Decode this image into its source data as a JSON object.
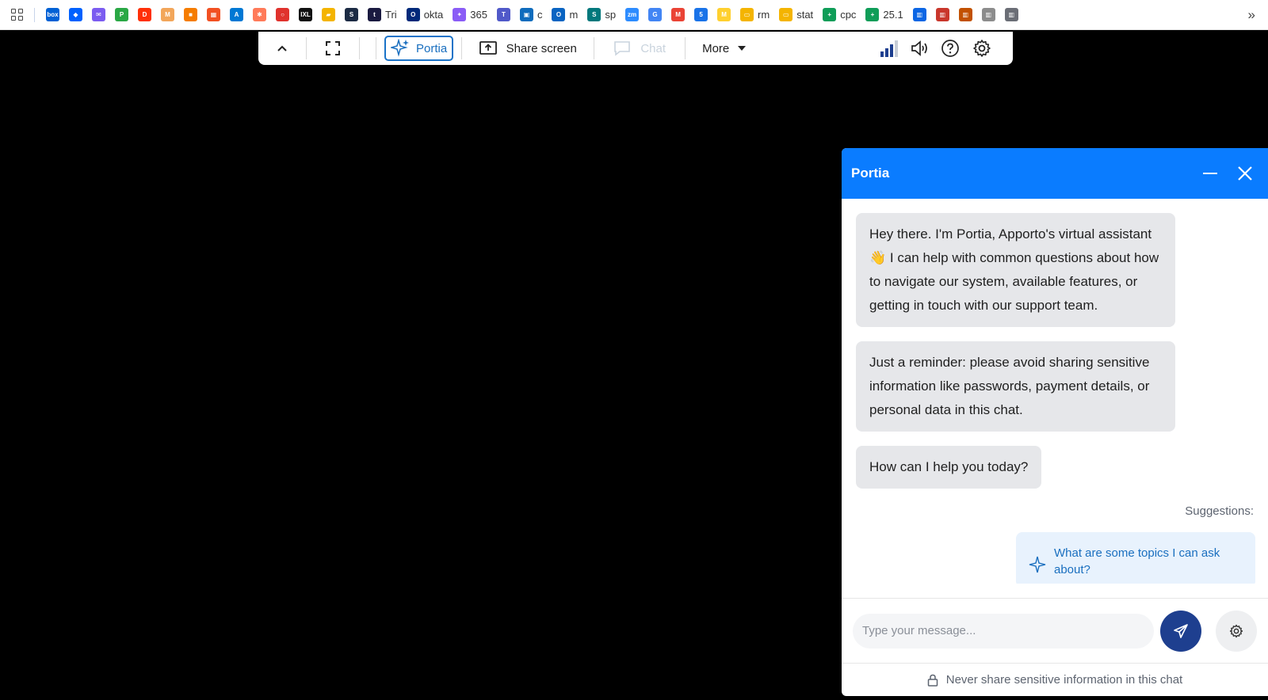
{
  "bookmarks": [
    {
      "icon": "apps-grid-icon",
      "label": ""
    },
    {
      "icon": "box-icon",
      "label": "",
      "color": "#0061d5",
      "glyph": "box"
    },
    {
      "icon": "dropbox-icon",
      "label": "",
      "color": "#0061fe",
      "glyph": "◆"
    },
    {
      "icon": "mail-icon",
      "label": "",
      "color": "#7b5cf0",
      "glyph": "✉"
    },
    {
      "icon": "p-icon",
      "label": "",
      "color": "#2aa845",
      "glyph": "P"
    },
    {
      "icon": "doordash-icon",
      "label": "",
      "color": "#ff3008",
      "glyph": "D"
    },
    {
      "icon": "m-icon",
      "label": "",
      "color": "#f2a65a",
      "glyph": "M"
    },
    {
      "icon": "cube-icon",
      "label": "",
      "color": "#f57c00",
      "glyph": "■"
    },
    {
      "icon": "microsoft-icon",
      "label": "",
      "color": "#f25022",
      "glyph": "▦"
    },
    {
      "icon": "azure-icon",
      "label": "",
      "color": "#0078d4",
      "glyph": "A"
    },
    {
      "icon": "hubspot-icon",
      "label": "",
      "color": "#ff7a59",
      "glyph": "✱"
    },
    {
      "icon": "ring-icon",
      "label": "",
      "color": "#e0322d",
      "glyph": "○"
    },
    {
      "icon": "ixl-icon",
      "label": "",
      "color": "#111111",
      "glyph": "IXL"
    },
    {
      "icon": "folder-icon",
      "label": "",
      "color": "#f4b400",
      "glyph": "▰"
    },
    {
      "icon": "s-icon",
      "label": "",
      "color": "#1c2b44",
      "glyph": "S"
    },
    {
      "icon": "t-icon",
      "label": "Tri",
      "color": "#1a1a40",
      "glyph": "t"
    },
    {
      "icon": "okta-icon",
      "label": "okta",
      "color": "#00297a",
      "glyph": "O"
    },
    {
      "icon": "copilot-icon",
      "label": "365",
      "color": "#8a5cf6",
      "glyph": "✦"
    },
    {
      "icon": "teams-icon",
      "label": "",
      "color": "#5059c9",
      "glyph": "T"
    },
    {
      "icon": "calendar-icon",
      "label": "c",
      "color": "#0f6cbd",
      "glyph": "▣"
    },
    {
      "icon": "outlook-icon",
      "label": "m",
      "color": "#0a64c2",
      "glyph": "O"
    },
    {
      "icon": "sharepoint-icon",
      "label": "sp",
      "color": "#03787c",
      "glyph": "S"
    },
    {
      "icon": "zoom-icon",
      "label": "",
      "color": "#2d8cff",
      "glyph": "zm"
    },
    {
      "icon": "google-icon",
      "label": "",
      "color": "#4285f4",
      "glyph": "G"
    },
    {
      "icon": "gmail-icon",
      "label": "",
      "color": "#ea4335",
      "glyph": "M"
    },
    {
      "icon": "calendar-5-icon",
      "label": "",
      "color": "#1a73e8",
      "glyph": "5"
    },
    {
      "icon": "miro-icon",
      "label": "",
      "color": "#ffd02f",
      "glyph": "M"
    },
    {
      "icon": "slides-icon",
      "label": "rm",
      "color": "#f4b400",
      "glyph": "▭"
    },
    {
      "icon": "slides-icon",
      "label": "stat",
      "color": "#f4b400",
      "glyph": "▭"
    },
    {
      "icon": "sheets-icon",
      "label": "cpc",
      "color": "#0f9d58",
      "glyph": "+"
    },
    {
      "icon": "sheets-icon",
      "label": "25.1",
      "color": "#0f9d58",
      "glyph": "+"
    },
    {
      "icon": "trello-icon",
      "label": "",
      "color": "#0c66e4",
      "glyph": "▥"
    },
    {
      "icon": "trello-icon",
      "label": "",
      "color": "#c9372c",
      "glyph": "▥"
    },
    {
      "icon": "trello-icon",
      "label": "",
      "color": "#c25100",
      "glyph": "▥"
    },
    {
      "icon": "trello-icon",
      "label": "",
      "color": "#8c8c8c",
      "glyph": "▥"
    },
    {
      "icon": "trello-icon",
      "label": "",
      "color": "#6b6e76",
      "glyph": "▥"
    }
  ],
  "bookmarks_overflow": "»",
  "toolbar": {
    "portia_label": "Portia",
    "share_label": "Share screen",
    "chat_label": "Chat",
    "more_label": "More"
  },
  "panel": {
    "title": "Portia",
    "messages": [
      "Hey there. I'm Portia, Apporto's virtual assistant 👋 I can help with common questions about how to navigate our system, available features, or getting in touch with our support team.",
      "Just a reminder: please avoid sharing sensitive information like passwords, payment details, or personal data in this chat.",
      "How can I help you today?"
    ],
    "suggestions_label": "Suggestions:",
    "suggestions": [
      "What are some topics I can ask about?"
    ],
    "input_placeholder": "Type your message...",
    "footer_note": "Never share sensitive information in this chat"
  },
  "colors": {
    "header_blue": "#0a7cff",
    "send_button": "#1e3f8f",
    "bubble": "#e6e7ea",
    "suggestion_bg": "#e8f2fd"
  }
}
